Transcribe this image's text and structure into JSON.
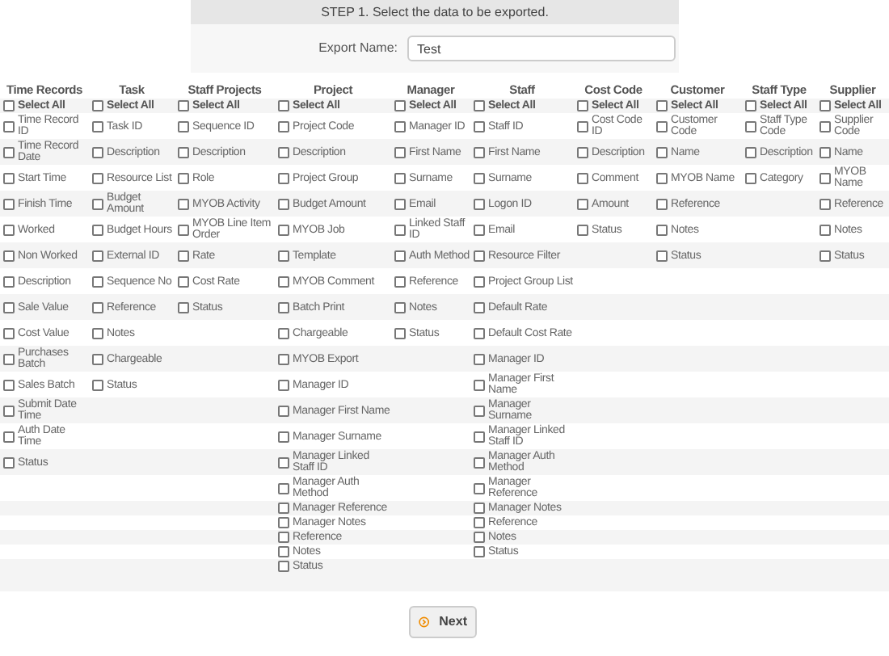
{
  "step_title": "STEP 1. Select the data to be exported.",
  "export_name": {
    "label": "Export Name:",
    "value": "Test"
  },
  "columns": [
    {
      "title": "Time Records",
      "select_all": {
        "label": "Select All",
        "checked": false
      },
      "fields": [
        {
          "label": "Time Record ID",
          "checked": false
        },
        {
          "label": "Time Record Date",
          "checked": false
        },
        {
          "label": "Start Time",
          "checked": false
        },
        {
          "label": "Finish Time",
          "checked": false
        },
        {
          "label": "Worked",
          "checked": false
        },
        {
          "label": "Non Worked",
          "checked": false
        },
        {
          "label": "Description",
          "checked": false
        },
        {
          "label": "Sale Value",
          "checked": false
        },
        {
          "label": "Cost Value",
          "checked": false
        },
        {
          "label": "Purchases Batch",
          "checked": false
        },
        {
          "label": "Sales Batch",
          "checked": false
        },
        {
          "label": "Submit Date Time",
          "checked": false
        },
        {
          "label": "Auth Date Time",
          "checked": false
        },
        {
          "label": "Status",
          "checked": false
        }
      ]
    },
    {
      "title": "Task",
      "select_all": {
        "label": "Select All",
        "checked": false
      },
      "fields": [
        {
          "label": "Task ID",
          "checked": false
        },
        {
          "label": "Description",
          "checked": false
        },
        {
          "label": "Resource List",
          "checked": false
        },
        {
          "label": "Budget Amount",
          "checked": false
        },
        {
          "label": "Budget Hours",
          "checked": false
        },
        {
          "label": "External ID",
          "checked": false
        },
        {
          "label": "Sequence No",
          "checked": false
        },
        {
          "label": "Reference",
          "checked": false
        },
        {
          "label": "Notes",
          "checked": false
        },
        {
          "label": "Chargeable",
          "checked": false
        },
        {
          "label": "Status",
          "checked": false
        }
      ]
    },
    {
      "title": "Staff Projects",
      "select_all": {
        "label": "Select All",
        "checked": false
      },
      "fields": [
        {
          "label": "Sequence ID",
          "checked": false
        },
        {
          "label": "Description",
          "checked": false
        },
        {
          "label": "Role",
          "checked": false
        },
        {
          "label": "MYOB Activity",
          "checked": false
        },
        {
          "label": "MYOB Line Item Order",
          "checked": false
        },
        {
          "label": "Rate",
          "checked": false
        },
        {
          "label": "Cost Rate",
          "checked": false
        },
        {
          "label": "Status",
          "checked": false
        }
      ]
    },
    {
      "title": "Project",
      "select_all": {
        "label": "Select All",
        "checked": false
      },
      "fields": [
        {
          "label": "Project Code",
          "checked": false
        },
        {
          "label": "Description",
          "checked": false
        },
        {
          "label": "Project Group",
          "checked": false
        },
        {
          "label": "Budget Amount",
          "checked": false
        },
        {
          "label": "MYOB Job",
          "checked": false
        },
        {
          "label": "Template",
          "checked": false
        },
        {
          "label": "MYOB Comment",
          "checked": false
        },
        {
          "label": "Batch Print",
          "checked": false
        },
        {
          "label": "Chargeable",
          "checked": false
        },
        {
          "label": "MYOB Export",
          "checked": false
        },
        {
          "label": "Manager ID",
          "checked": false
        },
        {
          "label": "Manager First Name",
          "checked": false
        },
        {
          "label": "Manager Surname",
          "checked": false
        },
        {
          "label": "Manager Linked Staff ID",
          "checked": false
        },
        {
          "label": "Manager Auth Method",
          "checked": false
        },
        {
          "label": "Manager Reference",
          "checked": false
        },
        {
          "label": "Manager Notes",
          "checked": false
        },
        {
          "label": "Reference",
          "checked": false
        },
        {
          "label": "Notes",
          "checked": false
        },
        {
          "label": "Status",
          "checked": false
        }
      ]
    },
    {
      "title": "Manager",
      "select_all": {
        "label": "Select All",
        "checked": false
      },
      "fields": [
        {
          "label": "Manager ID",
          "checked": false
        },
        {
          "label": "First Name",
          "checked": false
        },
        {
          "label": "Surname",
          "checked": false
        },
        {
          "label": "Email",
          "checked": false
        },
        {
          "label": "Linked Staff ID",
          "checked": false
        },
        {
          "label": "Auth Method",
          "checked": false
        },
        {
          "label": "Reference",
          "checked": false
        },
        {
          "label": "Notes",
          "checked": false
        },
        {
          "label": "Status",
          "checked": false
        }
      ]
    },
    {
      "title": "Staff",
      "select_all": {
        "label": "Select All",
        "checked": false
      },
      "fields": [
        {
          "label": "Staff ID",
          "checked": false
        },
        {
          "label": "First Name",
          "checked": false
        },
        {
          "label": "Surname",
          "checked": false
        },
        {
          "label": "Logon ID",
          "checked": false
        },
        {
          "label": "Email",
          "checked": false
        },
        {
          "label": "Resource Filter",
          "checked": false
        },
        {
          "label": "Project Group List",
          "checked": false
        },
        {
          "label": "Default Rate",
          "checked": false
        },
        {
          "label": "Default Cost Rate",
          "checked": false
        },
        {
          "label": "Manager ID",
          "checked": false
        },
        {
          "label": "Manager First Name",
          "checked": false
        },
        {
          "label": "Manager Surname",
          "checked": false
        },
        {
          "label": "Manager Linked Staff ID",
          "checked": false
        },
        {
          "label": "Manager Auth Method",
          "checked": false
        },
        {
          "label": "Manager Reference",
          "checked": false
        },
        {
          "label": "Manager Notes",
          "checked": false
        },
        {
          "label": "Reference",
          "checked": false
        },
        {
          "label": "Notes",
          "checked": false
        },
        {
          "label": "Status",
          "checked": false
        }
      ]
    },
    {
      "title": "Cost Code",
      "select_all": {
        "label": "Select All",
        "checked": false
      },
      "fields": [
        {
          "label": "Cost Code ID",
          "checked": false
        },
        {
          "label": "Description",
          "checked": false
        },
        {
          "label": "Comment",
          "checked": false
        },
        {
          "label": "Amount",
          "checked": false
        },
        {
          "label": "Status",
          "checked": false
        }
      ]
    },
    {
      "title": "Customer",
      "select_all": {
        "label": "Select All",
        "checked": false
      },
      "fields": [
        {
          "label": "Customer Code",
          "checked": false
        },
        {
          "label": "Name",
          "checked": false
        },
        {
          "label": "MYOB Name",
          "checked": false
        },
        {
          "label": "Reference",
          "checked": false
        },
        {
          "label": "Notes",
          "checked": false
        },
        {
          "label": "Status",
          "checked": false
        }
      ]
    },
    {
      "title": "Staff Type",
      "select_all": {
        "label": "Select All",
        "checked": false
      },
      "fields": [
        {
          "label": "Staff Type Code",
          "checked": false
        },
        {
          "label": "Description",
          "checked": false
        },
        {
          "label": "Category",
          "checked": false
        }
      ]
    },
    {
      "title": "Supplier",
      "select_all": {
        "label": "Select All",
        "checked": false
      },
      "fields": [
        {
          "label": "Supplier Code",
          "checked": false
        },
        {
          "label": "Name",
          "checked": false
        },
        {
          "label": "MYOB Name",
          "checked": false
        },
        {
          "label": "Reference",
          "checked": false
        },
        {
          "label": "Notes",
          "checked": false
        },
        {
          "label": "Status",
          "checked": false
        }
      ]
    }
  ],
  "next_button": "Next"
}
